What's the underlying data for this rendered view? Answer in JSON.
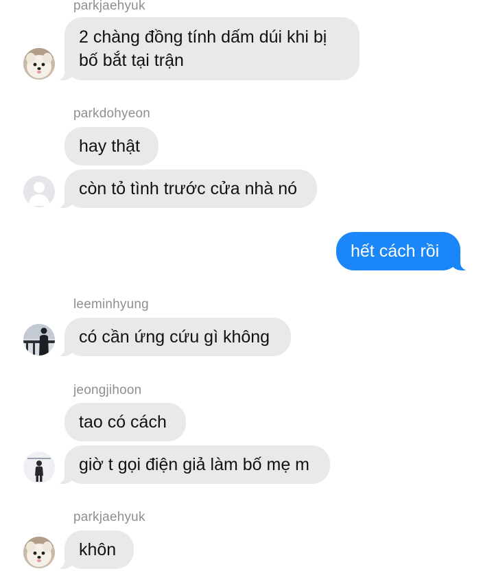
{
  "messages": [
    {
      "sender": "parkjaehyuk",
      "lines": [
        "2 chàng đồng tính dấm dúi khi bị",
        "bố bắt tại trận"
      ]
    },
    {
      "sender": "parkdohyeon",
      "text": "hay thật"
    },
    {
      "text": "còn tỏ tình trước cửa nhà nó"
    },
    {
      "direction": "outgoing",
      "text": "hết cách rồi"
    },
    {
      "sender": "leeminhyung",
      "text": "có cần ứng cứu gì không"
    },
    {
      "sender": "jeongjihoon",
      "text": "tao có cách"
    },
    {
      "text": "giờ t gọi điện giả làm bố mẹ m"
    },
    {
      "sender": "parkjaehyuk",
      "text": "khôn"
    }
  ],
  "avatars": {
    "parkjaehyuk": "white-dog-photo",
    "parkdohyeon": "default-person-placeholder",
    "leeminhyung": "person-silhouette-at-railing-photo",
    "jeongjihoon": "person-standing-photo"
  },
  "colors": {
    "incoming_bubble": "#e9e9eb",
    "outgoing_bubble": "#1a86f7",
    "sender_name": "#8e8e93"
  }
}
